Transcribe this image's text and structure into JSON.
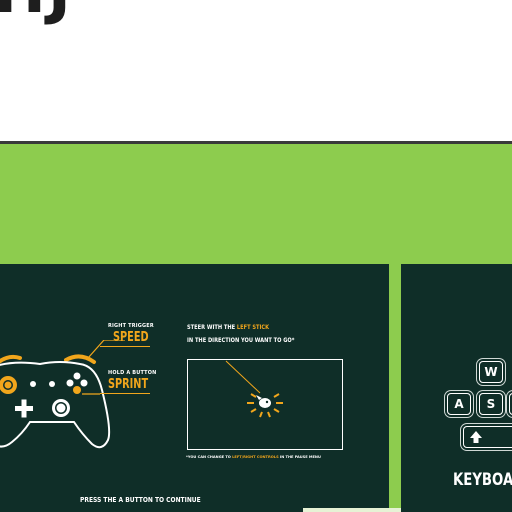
{
  "header": {
    "title": "HJ"
  },
  "controller_panel": {
    "right_trigger_caption": "RIGHT TRIGGER",
    "right_trigger_action": "SPEED",
    "hold_a_caption": "HOLD A BUTTON",
    "hold_a_action": "SPRINT",
    "steer_line1_prefix": "STEER WITH THE ",
    "steer_line1_highlight": "LEFT STICK",
    "steer_line2": "IN THE DIRECTION YOU WANT TO GO*",
    "footnote_prefix": "*YOU CAN CHANGE TO ",
    "footnote_highlight": "LEFT/RIGHT CONTROLS",
    "footnote_suffix": " IN THE PAUSE MENU",
    "press_to_continue": "PRESS THE A BUTTON TO CONTINUE"
  },
  "keyboard_panel": {
    "keys": [
      "W",
      "A",
      "S"
    ],
    "label": "KEYBOAR"
  },
  "colors": {
    "band_green": "#8dcc4e",
    "panel_dark": "#0f2e28",
    "accent_orange": "#f1a61c",
    "title_dark": "#1e1e1e"
  },
  "icons": [
    "controller-icon",
    "fish-icon",
    "shift-arrow-icon"
  ]
}
